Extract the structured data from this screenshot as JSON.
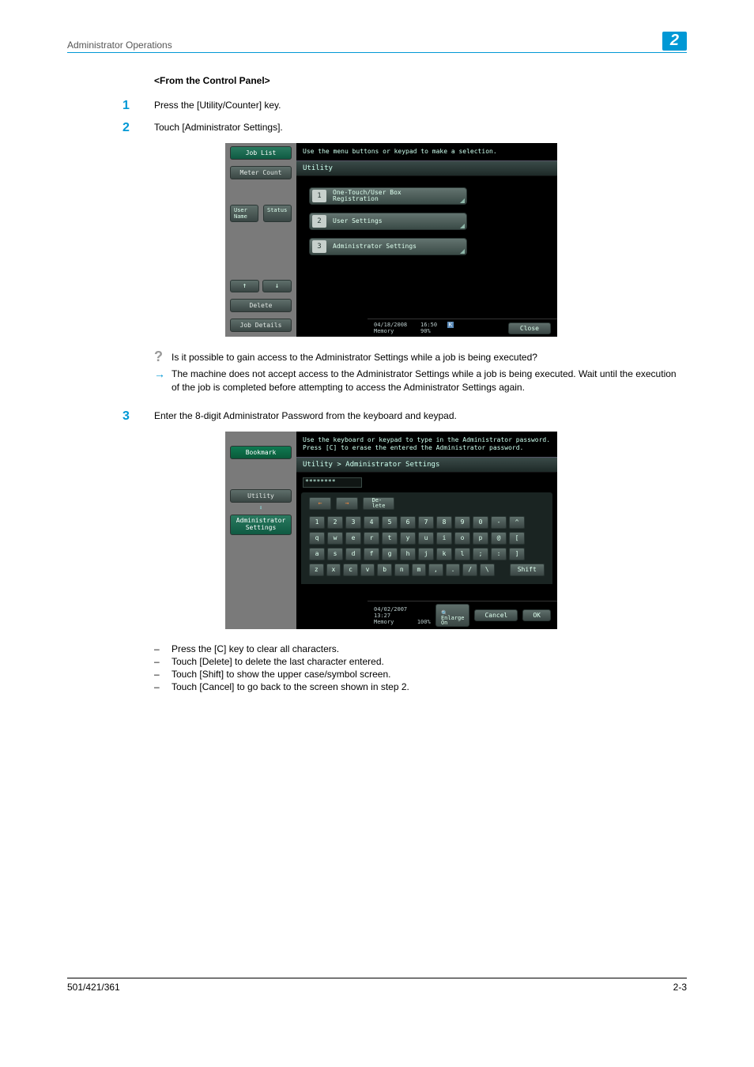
{
  "header": {
    "title": "Administrator Operations",
    "chapter": "2"
  },
  "h_sub": "<From the Control Panel>",
  "step1": {
    "n": "1",
    "text": "Press the [Utility/Counter] key."
  },
  "step2": {
    "n": "2",
    "text": "Touch [Administrator Settings]."
  },
  "panel1": {
    "tabs": {
      "joblist": "Job List",
      "meter": "Meter Count",
      "user": "User\nName",
      "status": "Status",
      "delete": "Delete",
      "jobdet": "Job Details"
    },
    "msg": "Use the menu buttons or keypad to make a selection.",
    "title": "Utility",
    "menu": {
      "one": {
        "n": "1",
        "label": "One-Touch/User Box\nRegistration"
      },
      "two": {
        "n": "2",
        "label": "User Settings"
      },
      "three": {
        "n": "3",
        "label": "Administrator Settings"
      }
    },
    "footer": {
      "date": "04/18/2008",
      "time": "16:50",
      "mem": "Memory",
      "mempct": "90%",
      "close": "Close"
    }
  },
  "qa": {
    "q": "Is it possible to gain access to the Administrator Settings while a job is being executed?",
    "a": "The machine does not accept access to the Administrator Settings while a job is being executed. Wait until the execution of the job is completed before attempting to access the Administrator Settings again."
  },
  "step3": {
    "n": "3",
    "text": "Enter the 8-digit Administrator Password from the keyboard and keypad."
  },
  "panel2": {
    "tabs": {
      "bookmark": "Bookmark",
      "utility": "Utility",
      "admin": "Administrator\nSettings"
    },
    "msg1": "Use the keyboard or keypad to type in the Administrator password.",
    "msg2": "Press [C] to erase the entered the Administrator password.",
    "title": "Utility > Administrator Settings",
    "input": "********",
    "ctrl": {
      "left": "←",
      "right": "→",
      "del": "De-\nlete"
    },
    "rows": {
      "r1": [
        "1",
        "2",
        "3",
        "4",
        "5",
        "6",
        "7",
        "8",
        "9",
        "0",
        "-",
        "^"
      ],
      "r2": [
        "q",
        "w",
        "e",
        "r",
        "t",
        "y",
        "u",
        "i",
        "o",
        "p",
        "@",
        "["
      ],
      "r3": [
        "a",
        "s",
        "d",
        "f",
        "g",
        "h",
        "j",
        "k",
        "l",
        ";",
        ":",
        "]"
      ],
      "r4": [
        "z",
        "x",
        "c",
        "v",
        "b",
        "n",
        "m",
        ",",
        ".",
        "/",
        "\\"
      ],
      "shift": "Shift"
    },
    "footer": {
      "date": "04/02/2007",
      "time": "13:27",
      "mem": "Memory",
      "mempct": "100%",
      "enlarge": "Enlarge\nOn",
      "cancel": "Cancel",
      "ok": "OK"
    }
  },
  "bullets": {
    "b1": "Press the [C] key to clear all characters.",
    "b2": "Touch [Delete] to delete the last character entered.",
    "b3": "Touch [Shift] to show the upper case/symbol screen.",
    "b4": "Touch [Cancel] to go back to the screen shown in step 2."
  },
  "footer": {
    "left": "501/421/361",
    "right": "2-3"
  }
}
